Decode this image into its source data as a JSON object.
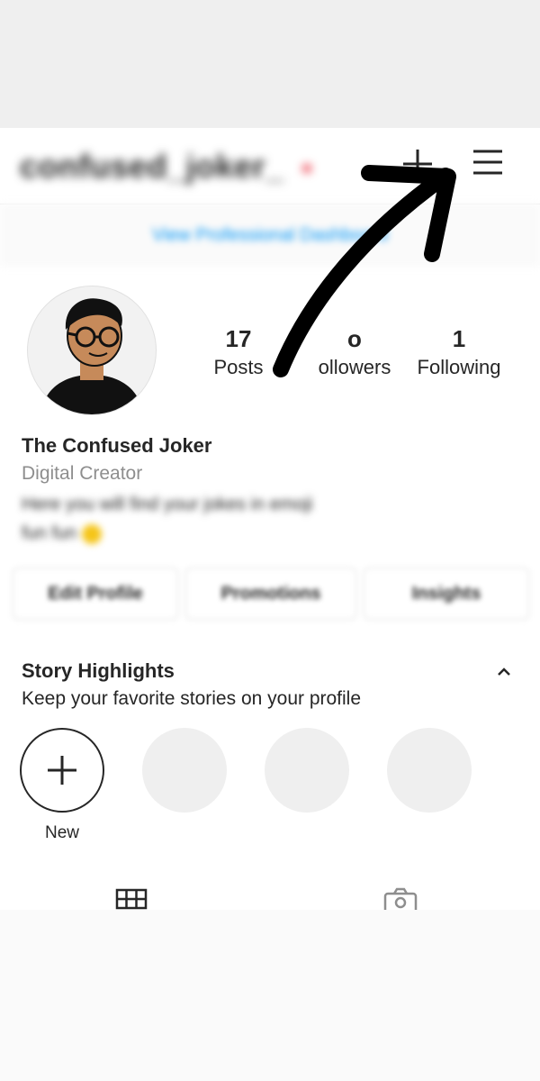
{
  "header": {
    "username": "confused_joker_",
    "professional_dashboard": "View Professional Dashboard"
  },
  "profile": {
    "full_name": "The Confused Joker",
    "category": "Digital Creator",
    "bio_line1": "Here you will find your jokes in emoji",
    "bio_line2": "fun fun",
    "stats": {
      "posts": {
        "value": "17",
        "label": "Posts"
      },
      "followers": {
        "value": "o",
        "label": "ollowers"
      },
      "following": {
        "value": "1",
        "label": "Following"
      }
    }
  },
  "actions": {
    "edit_profile": "Edit Profile",
    "promotions": "Promotions",
    "insights": "Insights"
  },
  "highlights": {
    "title": "Story Highlights",
    "subtitle": "Keep your favorite stories on your profile",
    "new_label": "New"
  },
  "colors": {
    "accent_blue": "#0095f6",
    "notification_red": "#ed4956",
    "text_primary": "#262626",
    "text_secondary": "#8e8e8e"
  },
  "icons": [
    "plus-icon",
    "hamburger-menu-icon",
    "chevron-up-icon",
    "grid-icon",
    "tagged-photos-icon"
  ]
}
